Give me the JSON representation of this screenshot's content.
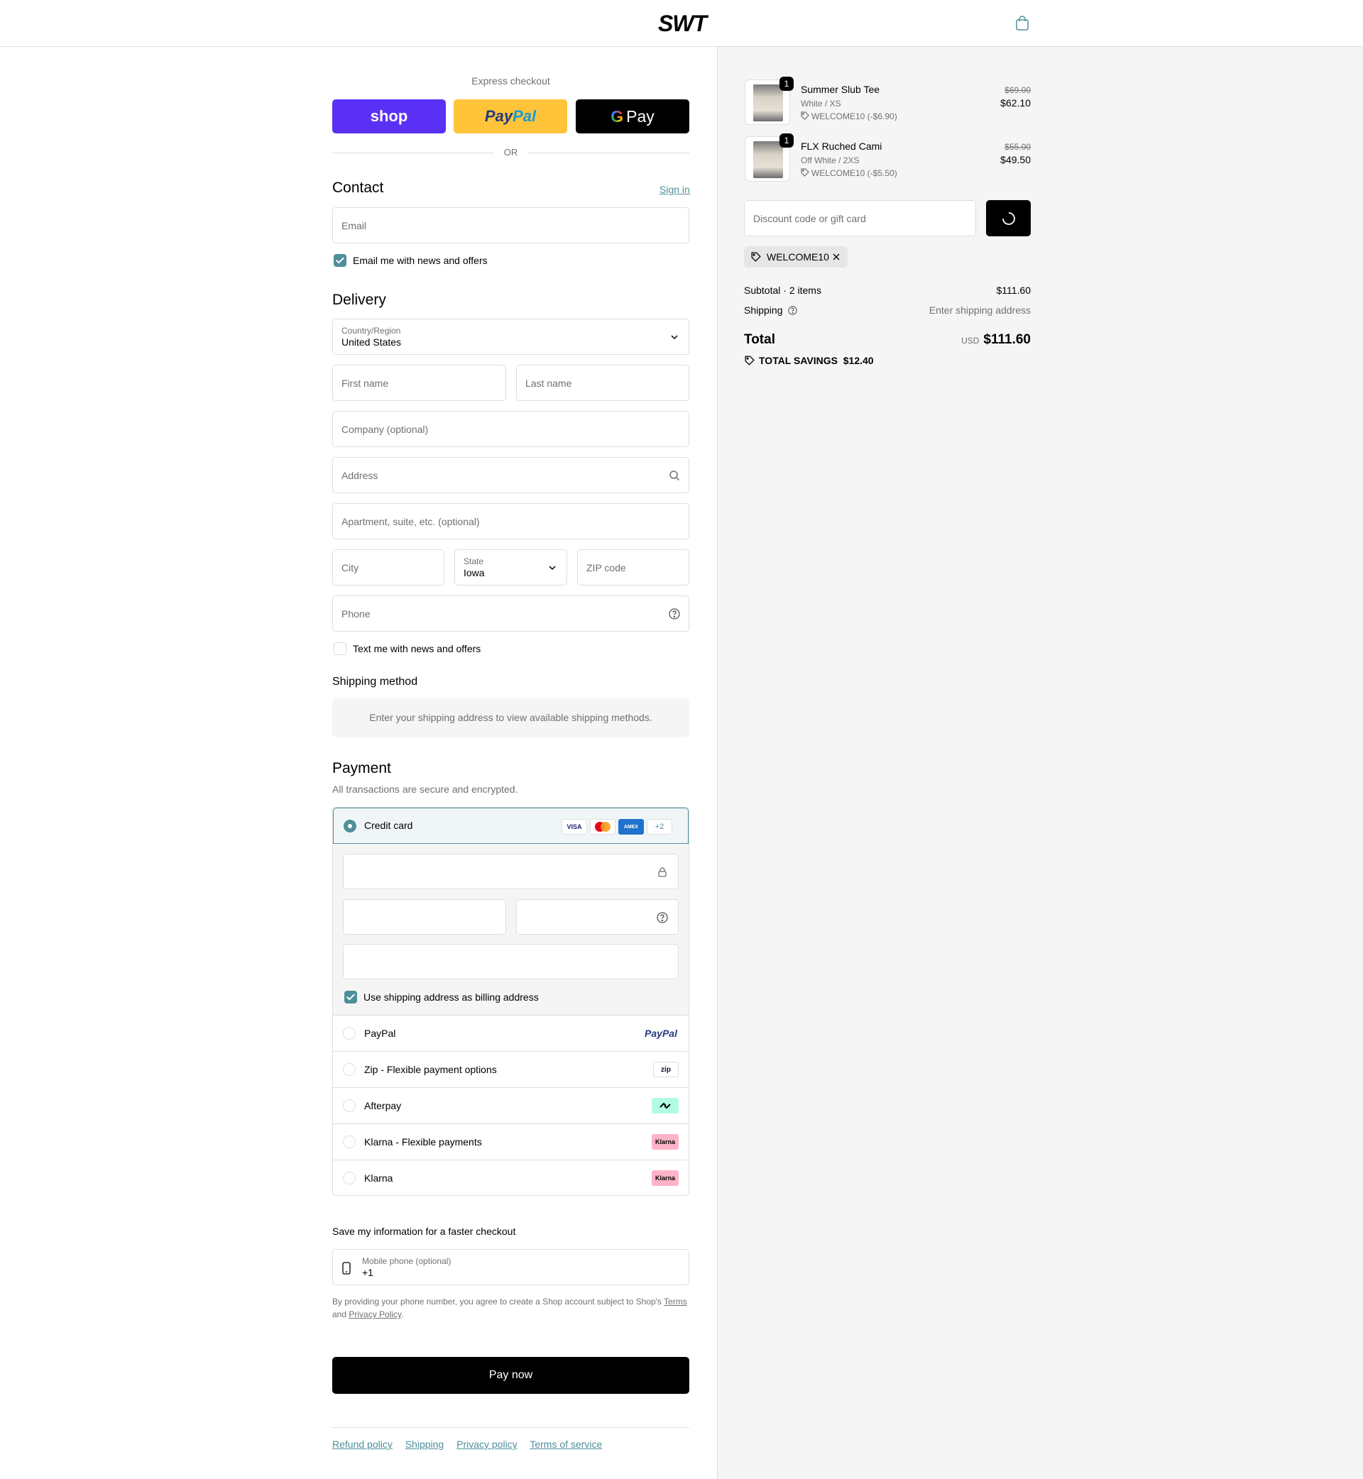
{
  "brand": {
    "logo_text": "SWT",
    "cart_icon": "shopping-bag-icon"
  },
  "express": {
    "title": "Express checkout",
    "shop_label": "shop",
    "paypal_label_1": "Pay",
    "paypal_label_2": "Pal",
    "gpay_g": "G",
    "gpay_label": "Pay",
    "or_label": "OR"
  },
  "contact": {
    "title": "Contact",
    "sign_in": "Sign in",
    "email_placeholder": "Email",
    "news_label": "Email me with news and offers",
    "news_checked": true
  },
  "delivery": {
    "title": "Delivery",
    "country_label": "Country/Region",
    "country_value": "United States",
    "first_name": "First name",
    "last_name": "Last name",
    "company": "Company (optional)",
    "address": "Address",
    "apartment": "Apartment, suite, etc. (optional)",
    "city": "City",
    "state_label": "State",
    "state_value": "Iowa",
    "zip": "ZIP code",
    "phone": "Phone",
    "text_label": "Text me with news and offers",
    "text_checked": false
  },
  "shipping_method": {
    "title": "Shipping method",
    "message": "Enter your shipping address to view available shipping methods."
  },
  "payment": {
    "title": "Payment",
    "subtitle": "All transactions are secure and encrypted.",
    "credit_card_label": "Credit card",
    "card_logos": [
      "VISA",
      "MASTERCARD",
      "AMEX"
    ],
    "more_cards": "+2",
    "billing_label": "Use shipping address as billing address",
    "billing_checked": true,
    "methods": [
      {
        "name": "PayPal",
        "badge": "PayPal"
      },
      {
        "name": "Zip - Flexible payment options",
        "badge": "zip"
      },
      {
        "name": "Afterpay",
        "badge": "afterpay"
      },
      {
        "name": "Klarna - Flexible payments",
        "badge": "Klarna"
      },
      {
        "name": "Klarna",
        "badge": "Klarna"
      }
    ],
    "colors": {
      "accent": "#4d8f9a",
      "afterpay": "#b2fce4",
      "klarna": "#ffb3c7"
    }
  },
  "save_info": {
    "title": "Save my information for a faster checkout",
    "phone_label": "Mobile phone (optional)",
    "phone_value": "+1",
    "legal_prefix": "By providing your phone number, you agree to create a Shop account subject to Shop's ",
    "terms": "Terms",
    "and": "and",
    "privacy": "Privacy Policy",
    "period": "."
  },
  "pay_now": "Pay now",
  "footer": [
    "Refund policy",
    "Shipping",
    "Privacy policy",
    "Terms of service"
  ],
  "order": {
    "items": [
      {
        "qty": "1",
        "name": "Summer Slub Tee",
        "variant": "White / XS",
        "discount": "WELCOME10 (-$6.90)",
        "old_price": "$69.00",
        "price": "$62.10"
      },
      {
        "qty": "1",
        "name": "FLX Ruched Cami",
        "variant": "Off White / 2XS",
        "discount": "WELCOME10 (-$5.50)",
        "old_price": "$55.00",
        "price": "$49.50"
      }
    ],
    "discount_placeholder": "Discount code or gift card",
    "applied_code": "WELCOME10",
    "subtotal_label": "Subtotal · 2 items",
    "subtotal_value": "$111.60",
    "shipping_label": "Shipping",
    "shipping_value": "Enter shipping address",
    "total_label": "Total",
    "currency": "USD",
    "total_value": "$111.60",
    "savings_label": "TOTAL SAVINGS",
    "savings_value": "$12.40"
  }
}
